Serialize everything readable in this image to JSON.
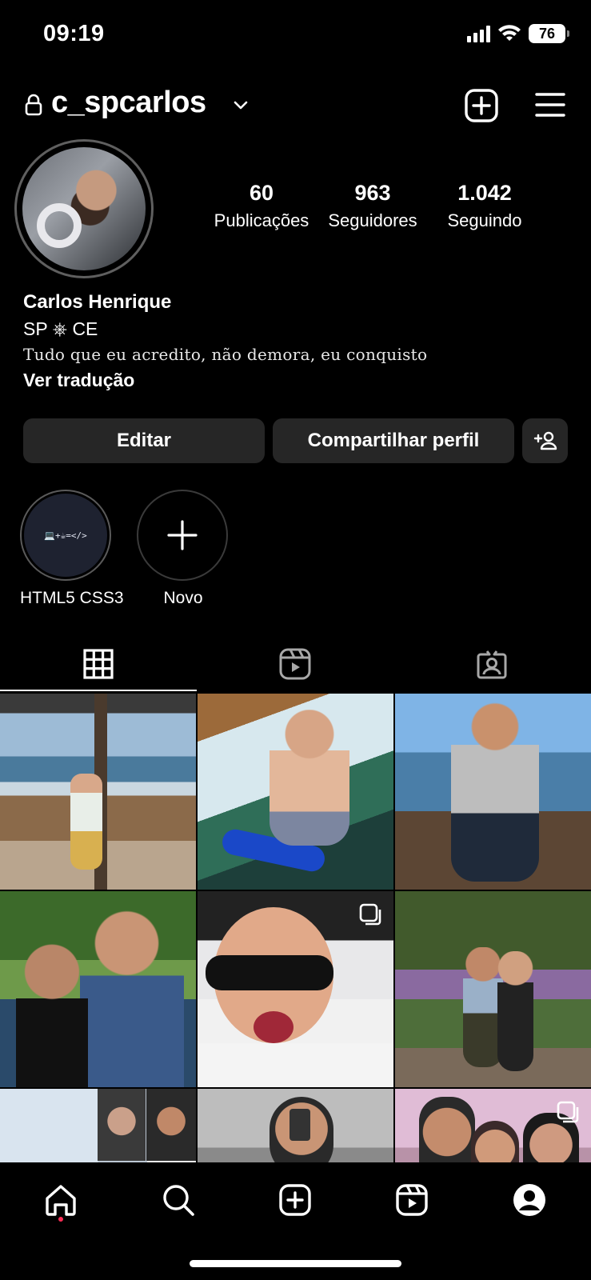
{
  "status": {
    "time": "09:19",
    "battery": "76"
  },
  "header": {
    "username": "c_spcarlos"
  },
  "stats": [
    {
      "value": "60",
      "label": "Publicações"
    },
    {
      "value": "963",
      "label": "Seguidores"
    },
    {
      "value": "1.042",
      "label": "Seguindo"
    }
  ],
  "bio": {
    "name": "Carlos Henrique",
    "line": "SP ⎈ CE",
    "quote": "Tudo que eu acredito, não demora, eu conquisto",
    "translate": "Ver tradução"
  },
  "actions": {
    "edit": "Editar",
    "share": "Compartilhar perfil"
  },
  "highlights": [
    {
      "label": "HTML5 CSS3",
      "cover_text": "💻+☕=</>"
    },
    {
      "label": "Novo"
    }
  ],
  "icons": {
    "lock": "lock-icon",
    "chevron": "chevron-down-icon",
    "new_post": "plus-square-icon",
    "menu": "hamburger-menu-icon",
    "add_person": "add-person-icon",
    "grid_tab": "grid-icon",
    "reels_tab": "reels-icon",
    "tagged_tab": "tagged-icon",
    "nav": [
      "home-icon",
      "search-icon",
      "create-icon",
      "reels-icon",
      "profile-icon"
    ]
  },
  "colors": {
    "background": "#000000",
    "button": "#262626",
    "notification_dot": "#ff2d55"
  }
}
